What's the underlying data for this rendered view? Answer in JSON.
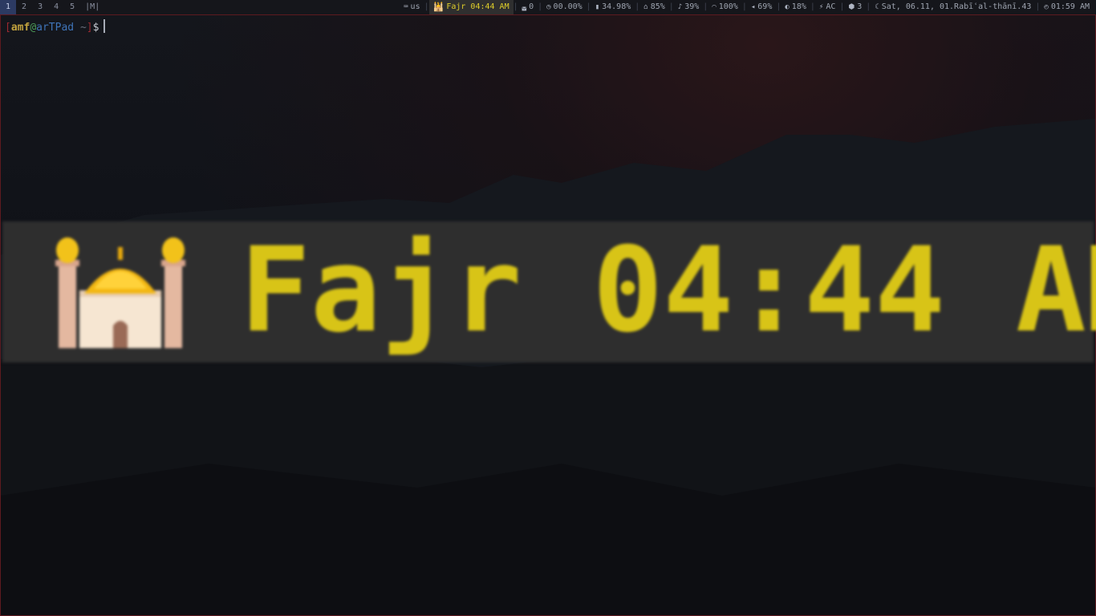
{
  "statusbar": {
    "workspaces": [
      "1",
      "2",
      "3",
      "4",
      "5"
    ],
    "active_workspace": "1",
    "layout_indicator": "|M|",
    "modules": [
      {
        "icon": "keyboard-icon",
        "glyph": "⌨",
        "value": "us"
      },
      {
        "icon": "mosque-icon",
        "glyph": "🕌",
        "value": "Fajr 04:44 AM",
        "highlight": true
      },
      {
        "icon": "hard-drive-icon",
        "glyph": "◛",
        "value": "0"
      },
      {
        "icon": "gauge-icon",
        "glyph": "◷",
        "value": "00.00%"
      },
      {
        "icon": "memory-icon",
        "glyph": "▮",
        "value": "34.98%"
      },
      {
        "icon": "home-icon",
        "glyph": "⌂",
        "value": "85%"
      },
      {
        "icon": "bell-icon",
        "glyph": "♪",
        "value": "39%"
      },
      {
        "icon": "wifi-icon",
        "glyph": "◠",
        "value": "100%"
      },
      {
        "icon": "volume-icon",
        "glyph": "◂",
        "value": "69%"
      },
      {
        "icon": "brightness-icon",
        "glyph": "◐",
        "value": "18%"
      },
      {
        "icon": "power-icon",
        "glyph": "⚡",
        "value": "AC"
      },
      {
        "icon": "package-icon",
        "glyph": "⬢",
        "value": "3"
      },
      {
        "icon": "moon-icon",
        "glyph": "☾",
        "value": "Sat, 06.11, 01.Rabīʿal-thānī.43"
      },
      {
        "icon": "clock-icon",
        "glyph": "◴",
        "value": "01:59 AM"
      }
    ]
  },
  "terminal": {
    "open_bracket": "[",
    "user": "amf",
    "at": "@",
    "host": "arTPad",
    "dir": "~",
    "close_bracket": "]",
    "dollar": "$"
  },
  "banner": {
    "icon": "mosque-icon",
    "text": "Fajr 04:44 AM"
  },
  "colors": {
    "bar_bg": "#15161b",
    "active_workspace_bg": "#2c3a62",
    "prayer_text": "#e0cf2a",
    "banner_bg": "#2e2e2e",
    "banner_text": "#d8c417",
    "terminal_border": "#5d1a1f"
  }
}
